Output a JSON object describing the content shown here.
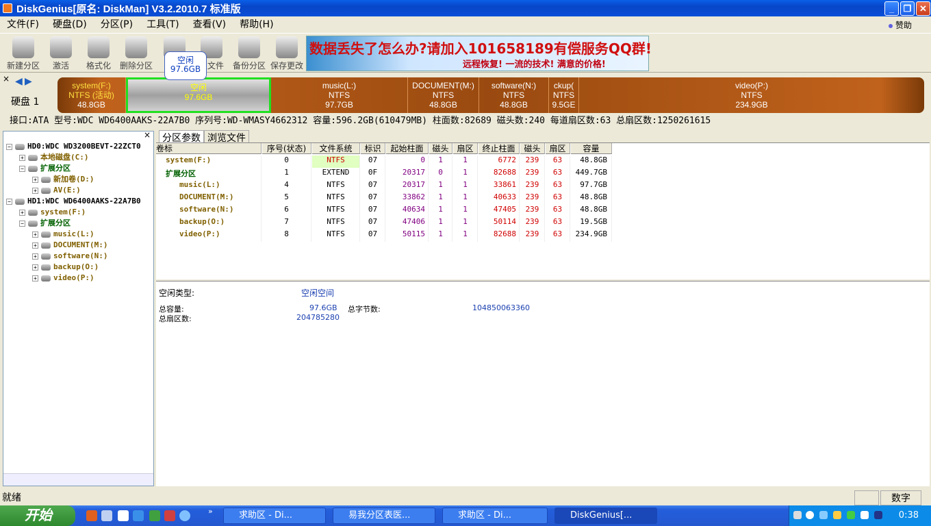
{
  "window": {
    "title": "DiskGenius[原名: DiskMan] V3.2.2010.7 标准版"
  },
  "menu": [
    "文件(F)",
    "硬盘(D)",
    "分区(P)",
    "工具(T)",
    "查看(V)",
    "帮助(H)"
  ],
  "sponsor": "赞助",
  "toolbar": [
    {
      "label": "新建分区",
      "icon": "new-partition-icon"
    },
    {
      "label": "激活",
      "icon": "activate-icon"
    },
    {
      "label": "格式化",
      "icon": "format-icon"
    },
    {
      "label": "删除分区",
      "icon": "delete-icon"
    },
    {
      "label": "搜",
      "icon": "search-icon"
    },
    {
      "label": "复文件",
      "icon": "restore-icon"
    },
    {
      "label": "备份分区",
      "icon": "backup-icon"
    },
    {
      "label": "保存更改",
      "icon": "save-icon"
    }
  ],
  "banner": {
    "line1": "数据丢失了怎么办?请加入101658189有偿服务QQ群!",
    "line2": "远程恢复!  一流的技术!  满意的价格!"
  },
  "disk_bar": {
    "label": "硬盘 1",
    "segments": [
      {
        "name": "system(F:)",
        "fs": "NTFS (活动)",
        "size": "48.8GB"
      },
      {
        "name": "空闲",
        "fs": "",
        "size": "97.6GB"
      },
      {
        "name": "music(L:)",
        "fs": "NTFS",
        "size": "97.7GB"
      },
      {
        "name": "DOCUMENT(M:)",
        "fs": "NTFS",
        "size": "48.8GB"
      },
      {
        "name": "software(N:)",
        "fs": "NTFS",
        "size": "48.8GB"
      },
      {
        "name": "ckup(",
        "fs": "NTFS",
        "size": "9.5GE"
      },
      {
        "name": "video(P:)",
        "fs": "NTFS",
        "size": "234.9GB"
      }
    ],
    "tooltip": {
      "name": "空闲",
      "size": "97.6GB"
    }
  },
  "disk_info": "接口:ATA   型号:WDC WD6400AAKS-22A7B0   序列号:WD-WMASY4662312   容量:596.2GB(610479MB)   柱面数:82689   磁头数:240   每道扇区数:63   总扇区数:1250261615",
  "tree": [
    {
      "label": "HD0:WDC WD3200BEVT-22ZCT0",
      "ex": "−",
      "indent": 0,
      "color": "dk"
    },
    {
      "label": "本地磁盘(C:)",
      "ex": "+",
      "indent": 1,
      "color": "gold"
    },
    {
      "label": "扩展分区",
      "ex": "−",
      "indent": 1,
      "color": "green"
    },
    {
      "label": "新加卷(D:)",
      "ex": "+",
      "indent": 2,
      "color": "gold"
    },
    {
      "label": "AV(E:)",
      "ex": "+",
      "indent": 2,
      "color": "gold"
    },
    {
      "label": "HD1:WDC WD6400AAKS-22A7B0",
      "ex": "−",
      "indent": 0,
      "color": "dk"
    },
    {
      "label": "system(F:)",
      "ex": "+",
      "indent": 1,
      "color": "gold"
    },
    {
      "label": "扩展分区",
      "ex": "−",
      "indent": 1,
      "color": "green"
    },
    {
      "label": "music(L:)",
      "ex": "+",
      "indent": 2,
      "color": "gold"
    },
    {
      "label": "DOCUMENT(M:)",
      "ex": "+",
      "indent": 2,
      "color": "gold"
    },
    {
      "label": "software(N:)",
      "ex": "+",
      "indent": 2,
      "color": "gold"
    },
    {
      "label": "backup(O:)",
      "ex": "+",
      "indent": 2,
      "color": "gold"
    },
    {
      "label": "video(P:)",
      "ex": "+",
      "indent": 2,
      "color": "gold"
    }
  ],
  "tabs": [
    "分区参数",
    "浏览文件"
  ],
  "table": {
    "headers": [
      "卷标",
      "序号(状态)",
      "文件系统",
      "标识",
      "起始柱面",
      "磁头",
      "扇区",
      "终止柱面",
      "磁头",
      "扇区",
      "容量"
    ],
    "rows": [
      [
        "system(F:)",
        "0",
        "NTFS",
        "07",
        "0",
        "1",
        "1",
        "6772",
        "239",
        "63",
        "48.8GB"
      ],
      [
        "扩展分区",
        "1",
        "EXTEND",
        "0F",
        "20317",
        "0",
        "1",
        "82688",
        "239",
        "63",
        "449.7GB"
      ],
      [
        "music(L:)",
        "4",
        "NTFS",
        "07",
        "20317",
        "1",
        "1",
        "33861",
        "239",
        "63",
        "97.7GB"
      ],
      [
        "DOCUMENT(M:)",
        "5",
        "NTFS",
        "07",
        "33862",
        "1",
        "1",
        "40633",
        "239",
        "63",
        "48.8GB"
      ],
      [
        "software(N:)",
        "6",
        "NTFS",
        "07",
        "40634",
        "1",
        "1",
        "47405",
        "239",
        "63",
        "48.8GB"
      ],
      [
        "backup(O:)",
        "7",
        "NTFS",
        "07",
        "47406",
        "1",
        "1",
        "50114",
        "239",
        "63",
        "19.5GB"
      ],
      [
        "video(P:)",
        "8",
        "NTFS",
        "07",
        "50115",
        "1",
        "1",
        "82688",
        "239",
        "63",
        "234.9GB"
      ]
    ]
  },
  "details": {
    "type_label": "空闲类型:",
    "type_value": "空闲空间",
    "cap_label": "总容量:",
    "cap_value": "97.6GB",
    "bytes_label": "总字节数:",
    "bytes_value": "104850063360",
    "sectors_label": "总扇区数:",
    "sectors_value": "204785280"
  },
  "status": {
    "text": "就绪",
    "num": "数字"
  },
  "taskbar": {
    "start": "开始",
    "tasks": [
      "求助区 - Di...",
      "易我分区表医...",
      "求助区 - Di...",
      "DiskGenius[..."
    ],
    "clock": "0:38"
  }
}
